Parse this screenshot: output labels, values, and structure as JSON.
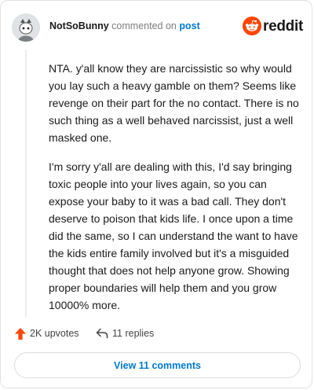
{
  "comment": {
    "username": "NotSoBunny",
    "action_text": "commented on",
    "post_link": "post",
    "paragraphs": [
      "NTA. y'all know they are narcissistic so why would you lay such a heavy gamble on them? Seems like revenge on their part for the no contact. There is no such thing as a well behaved narcissist, just a well masked one.",
      "I'm sorry y'all are dealing with this, I'd say bringing toxic people into your lives again, so you can expose your baby to it was a bad call. They don't deserve to poison that kids life. I once upon a time did the same, so I can understand the want to have the kids entire family involved but it's a misguided thought that does not help anyone grow. Showing proper boundaries will help them and you grow 10000% more."
    ]
  },
  "brand": {
    "name": "reddit",
    "color": "#ff4500"
  },
  "actions": {
    "upvotes_label": "2K upvotes",
    "replies_label": "11 replies",
    "upvote_color": "#ff4500"
  },
  "footer": {
    "view_comments_label": "View 11 comments",
    "accent": "#0079d3"
  },
  "icons": [
    "avatar-icon",
    "reddit-logo-icon",
    "upvote-arrow-icon",
    "reply-arrow-icon"
  ]
}
